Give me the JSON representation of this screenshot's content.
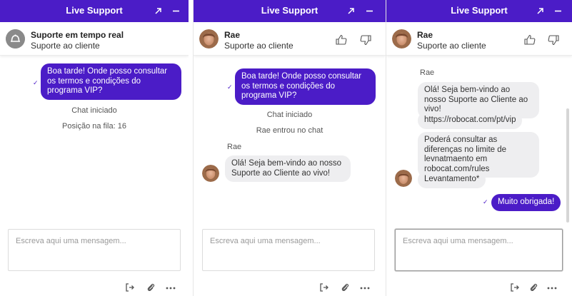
{
  "colors": {
    "brand": "#4b1cc7",
    "bubble_in": "#eeeef0"
  },
  "panel1": {
    "header": {
      "title": "Live Support",
      "popout_icon": "popout-arrow-icon",
      "minimize_icon": "minimize-icon"
    },
    "agent": {
      "name": "Suporte em tempo real",
      "subtitle": "Suporte ao cliente",
      "avatar_icon": "bell-icon"
    },
    "messages": {
      "user_question": "Boa tarde! Onde posso consultar os termos e condições do programa VIP?",
      "chat_started": "Chat iniciado",
      "queue_position": "Posição na fila: 16"
    },
    "composer": {
      "placeholder": "Escreva aqui uma mensagem..."
    },
    "tools": [
      "end-chat-icon",
      "attach-icon",
      "more-icon"
    ]
  },
  "panel2": {
    "header": {
      "title": "Live Support"
    },
    "agent": {
      "name": "Rae",
      "subtitle": "Suporte ao cliente"
    },
    "messages": {
      "user_question": "Boa tarde! Onde posso consultar os termos e condições do programa VIP?",
      "chat_started": "Chat iniciado",
      "agent_joined": "Rae entrou no chat",
      "agent_label": "Rae",
      "agent_welcome": "Olá! Seja bem-vindo ao nosso Suporte ao Cliente ao vivo!"
    },
    "composer": {
      "placeholder": "Escreva aqui uma mensagem..."
    }
  },
  "panel3": {
    "header": {
      "title": "Live Support"
    },
    "agent": {
      "name": "Rae",
      "subtitle": "Suporte ao cliente"
    },
    "messages": {
      "agent_label": "Rae",
      "agent_welcome": "Olá! Seja bem-vindo ao nosso Suporte ao Cliente ao vivo!",
      "link": "https://robocat.com/pt/vip",
      "diff_info": "Poderá consultar as diferenças no limite de levnatmaento em robocat.com/rules",
      "levantamento": "Levantamento*",
      "user_thanks": "Muito obrigada!"
    },
    "composer": {
      "placeholder": "Escreva aqui uma mensagem..."
    }
  }
}
